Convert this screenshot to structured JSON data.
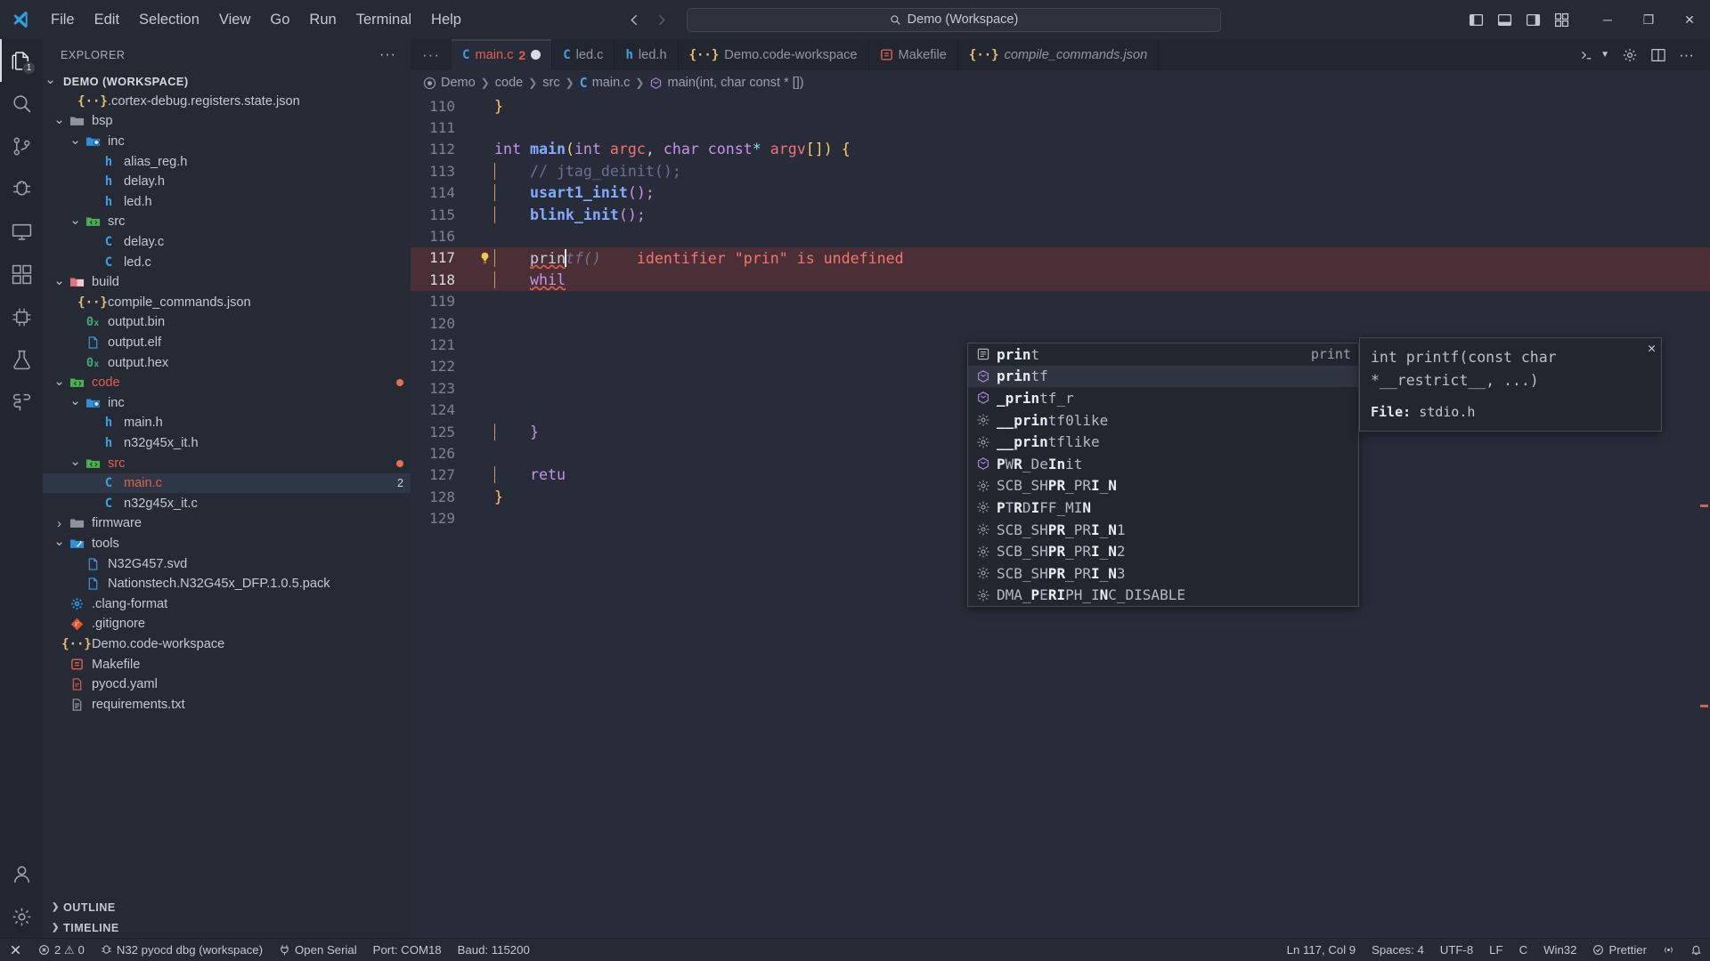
{
  "titlebar": {
    "menus": [
      "File",
      "Edit",
      "Selection",
      "View",
      "Go",
      "Run",
      "Terminal",
      "Help"
    ],
    "back_icon": "arrow-left-icon",
    "forward_icon": "arrow-right-icon",
    "quick_input_text": "Demo (Workspace)",
    "search_icon": "search-icon",
    "layout_icons": [
      "toggle-primary-sidebar-icon",
      "toggle-panel-icon",
      "toggle-secondary-sidebar-icon",
      "customize-layout-icon"
    ],
    "window_controls": {
      "minimize": "─",
      "maximize": "❐",
      "close": "✕"
    }
  },
  "activitybar": {
    "items": [
      {
        "name": "explorer",
        "icon": "files-icon",
        "badge": "1",
        "active": true
      },
      {
        "name": "search",
        "icon": "search-icon",
        "badge": "",
        "active": false
      },
      {
        "name": "source-control",
        "icon": "source-control-icon",
        "badge": "",
        "active": false
      },
      {
        "name": "run-and-debug",
        "icon": "debug-icon",
        "badge": "",
        "active": false
      },
      {
        "name": "remote-explorer",
        "icon": "remote-display-icon",
        "badge": "",
        "active": false
      },
      {
        "name": "extensions",
        "icon": "extensions-icon",
        "badge": "",
        "active": false
      },
      {
        "name": "embedded-tools",
        "icon": "chip-icon",
        "badge": "",
        "active": false
      },
      {
        "name": "testing",
        "icon": "beaker-icon",
        "badge": "",
        "active": false
      },
      {
        "name": "cmake",
        "icon": "puzzle-icon",
        "badge": "",
        "active": false
      }
    ],
    "bottom": [
      {
        "name": "accounts",
        "icon": "account-icon"
      },
      {
        "name": "manage-settings",
        "icon": "gear-icon"
      }
    ]
  },
  "sidebar": {
    "title": "EXPLORER",
    "actions_icon": "more-actions-icon",
    "tree": [
      {
        "label": "DEMO (WORKSPACE)",
        "indent": 0,
        "twisty": "down",
        "icon": "none",
        "kind": "root"
      },
      {
        "label": ".cortex-debug.registers.state.json",
        "indent": 2,
        "twisty": "none",
        "icon": "json-icon",
        "kind": "file"
      },
      {
        "label": "bsp",
        "indent": 1,
        "twisty": "down",
        "icon": "folder-grey-icon",
        "kind": "folder"
      },
      {
        "label": "inc",
        "indent": 2,
        "twisty": "down",
        "icon": "folder-include-icon",
        "kind": "folder"
      },
      {
        "label": "alias_reg.h",
        "indent": 3,
        "twisty": "none",
        "icon": "h-icon",
        "kind": "file"
      },
      {
        "label": "delay.h",
        "indent": 3,
        "twisty": "none",
        "icon": "h-icon",
        "kind": "file"
      },
      {
        "label": "led.h",
        "indent": 3,
        "twisty": "none",
        "icon": "h-icon",
        "kind": "file"
      },
      {
        "label": "src",
        "indent": 2,
        "twisty": "down",
        "icon": "folder-src-icon",
        "kind": "folder"
      },
      {
        "label": "delay.c",
        "indent": 3,
        "twisty": "none",
        "icon": "c-icon",
        "kind": "file"
      },
      {
        "label": "led.c",
        "indent": 3,
        "twisty": "none",
        "icon": "c-icon",
        "kind": "file"
      },
      {
        "label": "build",
        "indent": 1,
        "twisty": "down",
        "icon": "folder-build-icon",
        "kind": "folder"
      },
      {
        "label": "compile_commands.json",
        "indent": 2,
        "twisty": "none",
        "icon": "json-icon",
        "kind": "file"
      },
      {
        "label": "output.bin",
        "indent": 2,
        "twisty": "none",
        "icon": "binary-icon",
        "kind": "file"
      },
      {
        "label": "output.elf",
        "indent": 2,
        "twisty": "none",
        "icon": "file-blue-icon",
        "kind": "file"
      },
      {
        "label": "output.hex",
        "indent": 2,
        "twisty": "none",
        "icon": "binary-icon",
        "kind": "file"
      },
      {
        "label": "code",
        "indent": 1,
        "twisty": "down",
        "icon": "folder-src-icon",
        "kind": "folder",
        "modified": true,
        "dot": true
      },
      {
        "label": "inc",
        "indent": 2,
        "twisty": "down",
        "icon": "folder-include-icon",
        "kind": "folder"
      },
      {
        "label": "main.h",
        "indent": 3,
        "twisty": "none",
        "icon": "h-icon",
        "kind": "file"
      },
      {
        "label": "n32g45x_it.h",
        "indent": 3,
        "twisty": "none",
        "icon": "h-icon",
        "kind": "file"
      },
      {
        "label": "src",
        "indent": 2,
        "twisty": "down",
        "icon": "folder-src-icon",
        "kind": "folder",
        "modified": true,
        "dot": true
      },
      {
        "label": "main.c",
        "indent": 3,
        "twisty": "none",
        "icon": "c-icon",
        "kind": "file",
        "modified": true,
        "selected": true,
        "badge": "2"
      },
      {
        "label": "n32g45x_it.c",
        "indent": 3,
        "twisty": "none",
        "icon": "c-icon",
        "kind": "file"
      },
      {
        "label": "firmware",
        "indent": 1,
        "twisty": "right",
        "icon": "folder-grey-icon",
        "kind": "folder"
      },
      {
        "label": "tools",
        "indent": 1,
        "twisty": "down",
        "icon": "folder-tools-icon",
        "kind": "folder"
      },
      {
        "label": "N32G457.svd",
        "indent": 2,
        "twisty": "none",
        "icon": "file-blue-icon",
        "kind": "file"
      },
      {
        "label": "Nationstech.N32G45x_DFP.1.0.5.pack",
        "indent": 2,
        "twisty": "none",
        "icon": "file-blue-icon",
        "kind": "file"
      },
      {
        "label": ".clang-format",
        "indent": 1,
        "twisty": "none",
        "icon": "gear-blue-icon",
        "kind": "file"
      },
      {
        "label": ".gitignore",
        "indent": 1,
        "twisty": "none",
        "icon": "git-icon",
        "kind": "file"
      },
      {
        "label": "Demo.code-workspace",
        "indent": 1,
        "twisty": "none",
        "icon": "json-icon",
        "kind": "file"
      },
      {
        "label": "Makefile",
        "indent": 1,
        "twisty": "none",
        "icon": "makefile-icon",
        "kind": "file"
      },
      {
        "label": "pyocd.yaml",
        "indent": 1,
        "twisty": "none",
        "icon": "yaml-icon",
        "kind": "file"
      },
      {
        "label": "requirements.txt",
        "indent": 1,
        "twisty": "none",
        "icon": "txt-icon",
        "kind": "file"
      }
    ],
    "sections": [
      {
        "label": "OUTLINE",
        "twisty": "right"
      },
      {
        "label": "TIMELINE",
        "twisty": "right"
      }
    ]
  },
  "editor": {
    "more_tabs_icon": "more-tabs-icon",
    "tabs": [
      {
        "label": "main.c",
        "icon": "c-icon",
        "active": true,
        "error": true,
        "error_count": "2",
        "dirty": true,
        "italic": false
      },
      {
        "label": "led.c",
        "icon": "c-icon",
        "active": false,
        "error": false,
        "error_count": "",
        "dirty": false,
        "italic": false
      },
      {
        "label": "led.h",
        "icon": "h-icon",
        "active": false,
        "error": false,
        "error_count": "",
        "dirty": false,
        "italic": false
      },
      {
        "label": "Demo.code-workspace",
        "icon": "json-icon",
        "active": false,
        "error": false,
        "error_count": "",
        "dirty": false,
        "italic": false
      },
      {
        "label": "Makefile",
        "icon": "makefile-icon",
        "active": false,
        "error": false,
        "error_count": "",
        "dirty": false,
        "italic": false
      },
      {
        "label": "compile_commands.json",
        "icon": "json-icon",
        "active": false,
        "error": false,
        "error_count": "",
        "dirty": false,
        "italic": true
      }
    ],
    "tab_actions": [
      {
        "name": "run-debug-split-icon",
        "icon": "beaker-run-icon"
      },
      {
        "name": "settings-icon",
        "icon": "gear-icon"
      },
      {
        "name": "split-editor-icon",
        "icon": "split-icon"
      },
      {
        "name": "more-actions-icon",
        "icon": "ellipsis-icon"
      }
    ],
    "breadcrumbs": [
      {
        "label": "Demo",
        "icon": "workspace-icon"
      },
      {
        "label": "code",
        "icon": "none"
      },
      {
        "label": "src",
        "icon": "none"
      },
      {
        "label": "main.c",
        "icon": "c-icon"
      },
      {
        "label": "main(int, char const * [])",
        "icon": "symbol-method-icon"
      }
    ],
    "lines": [
      {
        "n": "110",
        "html": "partial-brace"
      },
      {
        "n": "111",
        "html": "blank"
      },
      {
        "n": "112",
        "html": "signature"
      },
      {
        "n": "113",
        "html": "comment"
      },
      {
        "n": "114",
        "html": "usart"
      },
      {
        "n": "115",
        "html": "blink"
      },
      {
        "n": "116",
        "html": "blank"
      },
      {
        "n": "117",
        "html": "printf-error"
      },
      {
        "n": "118",
        "html": "while"
      },
      {
        "n": "119",
        "html": "blank"
      },
      {
        "n": "120",
        "html": "blank"
      },
      {
        "n": "121",
        "html": "blank"
      },
      {
        "n": "122",
        "html": "blank"
      },
      {
        "n": "123",
        "html": "blank"
      },
      {
        "n": "124",
        "html": "blank"
      },
      {
        "n": "125",
        "html": "closebrace"
      },
      {
        "n": "126",
        "html": "blank"
      },
      {
        "n": "127",
        "html": "return"
      },
      {
        "n": "128",
        "html": "endbrace"
      },
      {
        "n": "129",
        "html": "blank"
      }
    ],
    "code": {
      "l110": "}",
      "l112_a": "int ",
      "l112_b": "main",
      "l112_c": "(",
      "l112_d": "int ",
      "l112_e": "argc",
      "l112_f": ", ",
      "l112_g": "char const",
      "l112_h": "* ",
      "l112_i": "argv",
      "l112_j": "[])",
      "l112_k": " {",
      "l113": "// jtag_deinit();",
      "l114_a": "usart1_init",
      "l114_b": "();",
      "l115_a": "blink_init",
      "l115_b": "();",
      "l117_typed": "prin",
      "l117_ghost": "tf()",
      "l117_error": "identifier \"prin\" is undefined",
      "l118": "whil",
      "l125": "}",
      "l127": "retu",
      "l128": "}"
    },
    "lightbulb_icon": "lightbulb-icon"
  },
  "suggest": {
    "items": [
      {
        "prefix": "",
        "match": "prin",
        "rest": "t",
        "icon": "symbol-snippet-icon",
        "detail": "print",
        "selected": false
      },
      {
        "prefix": "",
        "match": "prin",
        "rest": "tf",
        "icon": "symbol-function-icon",
        "detail": "",
        "selected": true
      },
      {
        "prefix": "_",
        "match": "prin",
        "rest": "tf_r",
        "icon": "symbol-function-icon",
        "detail": "",
        "selected": false
      },
      {
        "prefix": "__",
        "match": "prin",
        "rest": "tf0like",
        "icon": "symbol-constant-icon",
        "detail": "",
        "selected": false
      },
      {
        "prefix": "__",
        "match": "prin",
        "rest": "tflike",
        "icon": "symbol-constant-icon",
        "detail": "",
        "selected": false
      },
      {
        "prefix": "",
        "match": "P",
        "rest": "WR_DeInit",
        "icon": "symbol-function-icon",
        "detail": "",
        "selected": false,
        "pattern": "PWR_DeInit"
      },
      {
        "prefix": "",
        "match": "",
        "rest": "SCB_SHPR_PRI_N",
        "icon": "symbol-constant-icon",
        "detail": "",
        "selected": false,
        "pattern": "SCB_SHPR_PRI_N"
      },
      {
        "prefix": "",
        "match": "",
        "rest": "PTRDIFF_MIN",
        "icon": "symbol-constant-icon",
        "detail": "",
        "selected": false,
        "pattern": "PTRDIFF_MIN"
      },
      {
        "prefix": "",
        "match": "",
        "rest": "SCB_SHPR_PRI_N1",
        "icon": "symbol-constant-icon",
        "detail": "",
        "selected": false,
        "pattern": "SCB_SHPR_PRI_N1"
      },
      {
        "prefix": "",
        "match": "",
        "rest": "SCB_SHPR_PRI_N2",
        "icon": "symbol-constant-icon",
        "detail": "",
        "selected": false,
        "pattern": "SCB_SHPR_PRI_N2"
      },
      {
        "prefix": "",
        "match": "",
        "rest": "SCB_SHPR_PRI_N3",
        "icon": "symbol-constant-icon",
        "detail": "",
        "selected": false,
        "pattern": "SCB_SHPR_PRI_N3"
      },
      {
        "prefix": "",
        "match": "",
        "rest": "DMA_PERIPH_INC_DISABLE",
        "icon": "symbol-constant-icon",
        "detail": "",
        "selected": false,
        "pattern": "DMA_PERIPH_INC_DISABLE"
      }
    ],
    "doc": {
      "signature": "int printf(const char *__restrict__, ...)",
      "file_label": "File:",
      "file_name": "stdio.h",
      "close_icon": "close-icon"
    }
  },
  "statusbar": {
    "remote_icon": "remote-indicator-icon",
    "left": [
      {
        "name": "problems",
        "icon": "error-warning-icon",
        "text": "2 ⚠ 0",
        "errors": "2",
        "warnings": "0"
      },
      {
        "name": "debug-session",
        "icon": "debug-alt-icon",
        "text": "N32 pyocd dbg (workspace)"
      },
      {
        "name": "open-serial",
        "icon": "plug-icon",
        "text": "Open Serial"
      },
      {
        "name": "serial-port",
        "icon": "none",
        "text": "Port: COM18"
      },
      {
        "name": "baud-rate",
        "icon": "none",
        "text": "Baud: 115200"
      }
    ],
    "right": [
      {
        "name": "cursor-position",
        "icon": "none",
        "text": "Ln 117, Col 9"
      },
      {
        "name": "indentation",
        "icon": "none",
        "text": "Spaces: 4"
      },
      {
        "name": "encoding",
        "icon": "none",
        "text": "UTF-8"
      },
      {
        "name": "eol",
        "icon": "none",
        "text": "LF"
      },
      {
        "name": "language-mode",
        "icon": "none",
        "text": "C"
      },
      {
        "name": "platform",
        "icon": "none",
        "text": "Win32"
      },
      {
        "name": "prettier",
        "icon": "check-circle-icon",
        "text": "Prettier"
      },
      {
        "name": "edit-sessions",
        "icon": "broadcast-icon",
        "text": ""
      },
      {
        "name": "notifications",
        "icon": "bell-icon",
        "text": ""
      }
    ]
  },
  "colors": {
    "accent_blue": "#82aaff",
    "error_red": "#e0604f",
    "keyword_purple": "#c792ea",
    "warn_yellow": "#ffcb6b",
    "bg_editor": "#272c38",
    "bg_sidebar": "#252a35",
    "bg_activitybar": "#222631"
  }
}
